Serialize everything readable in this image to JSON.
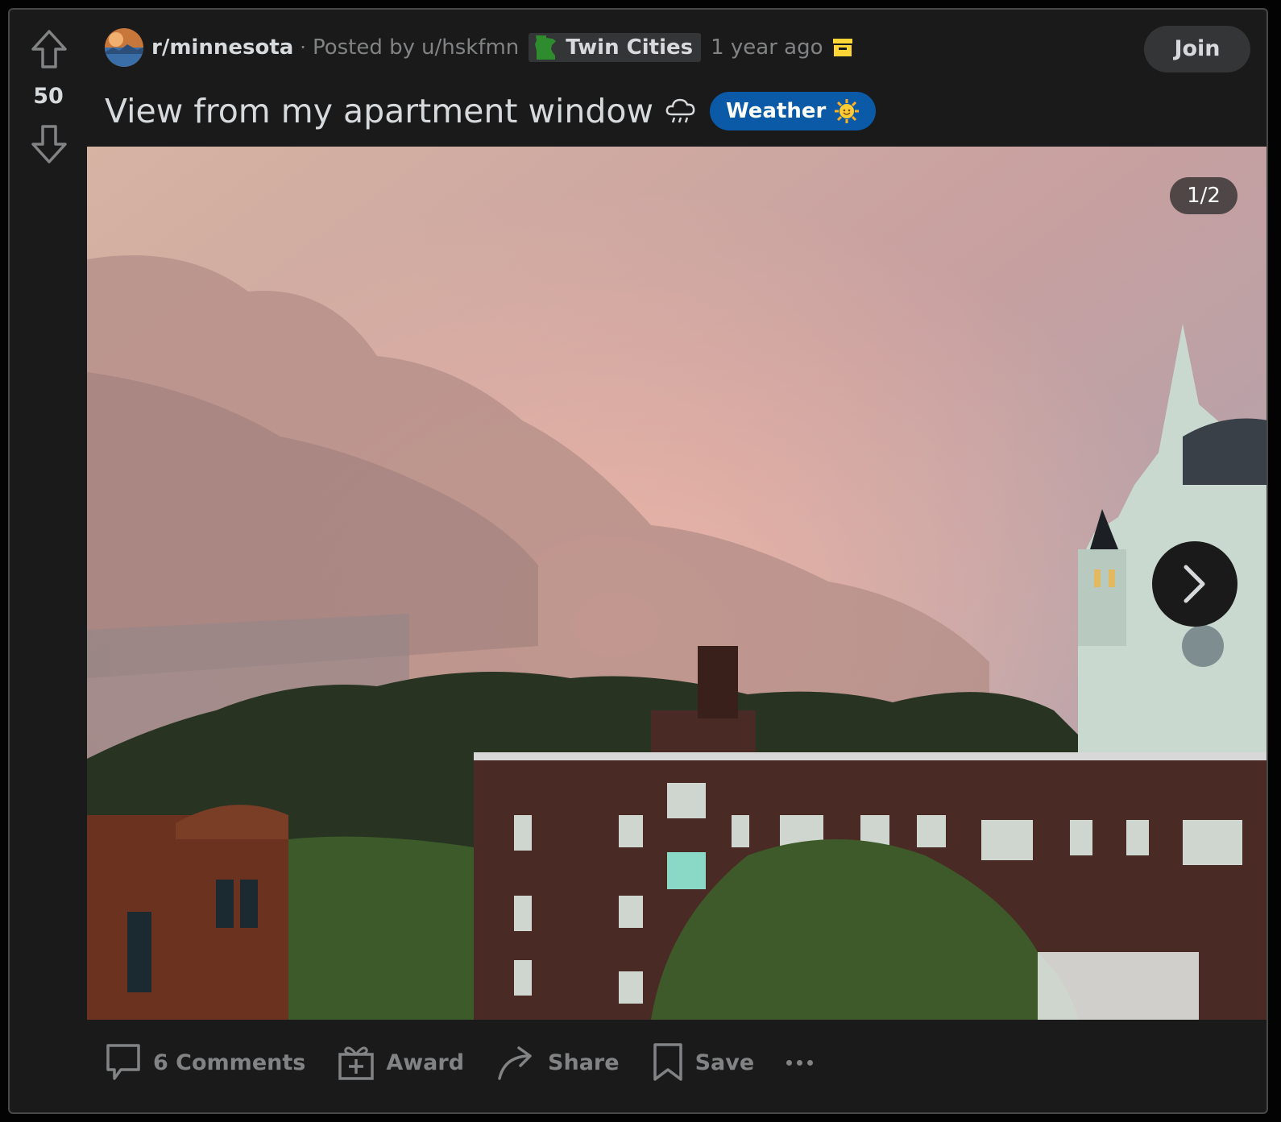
{
  "post": {
    "subreddit": "r/minnesota",
    "posted_by_prefix": "Posted by",
    "username": "u/hskfmn",
    "user_flair": "Twin Cities",
    "time_ago": "1 year ago",
    "title": "View from my apartment window",
    "link_flair": "Weather",
    "score": "50"
  },
  "header": {
    "join_label": "Join"
  },
  "media": {
    "counter": "1/2"
  },
  "actions": {
    "comments_label": "6 Comments",
    "award_label": "Award",
    "share_label": "Share",
    "save_label": "Save"
  },
  "colors": {
    "background": "#1a1a1b",
    "text": "#d7dadc",
    "meta": "#818384",
    "flair_blue": "#0a5aa8",
    "archive_yellow": "#ffd635"
  },
  "icons": [
    "upvote-icon",
    "downvote-icon",
    "subreddit-avatar-icon",
    "minnesota-flair-icon",
    "archive-icon",
    "rain-cloud-emoji-icon",
    "sun-emoji-icon",
    "chevron-right-icon",
    "comment-icon",
    "award-icon",
    "share-icon",
    "save-icon",
    "more-icon"
  ]
}
